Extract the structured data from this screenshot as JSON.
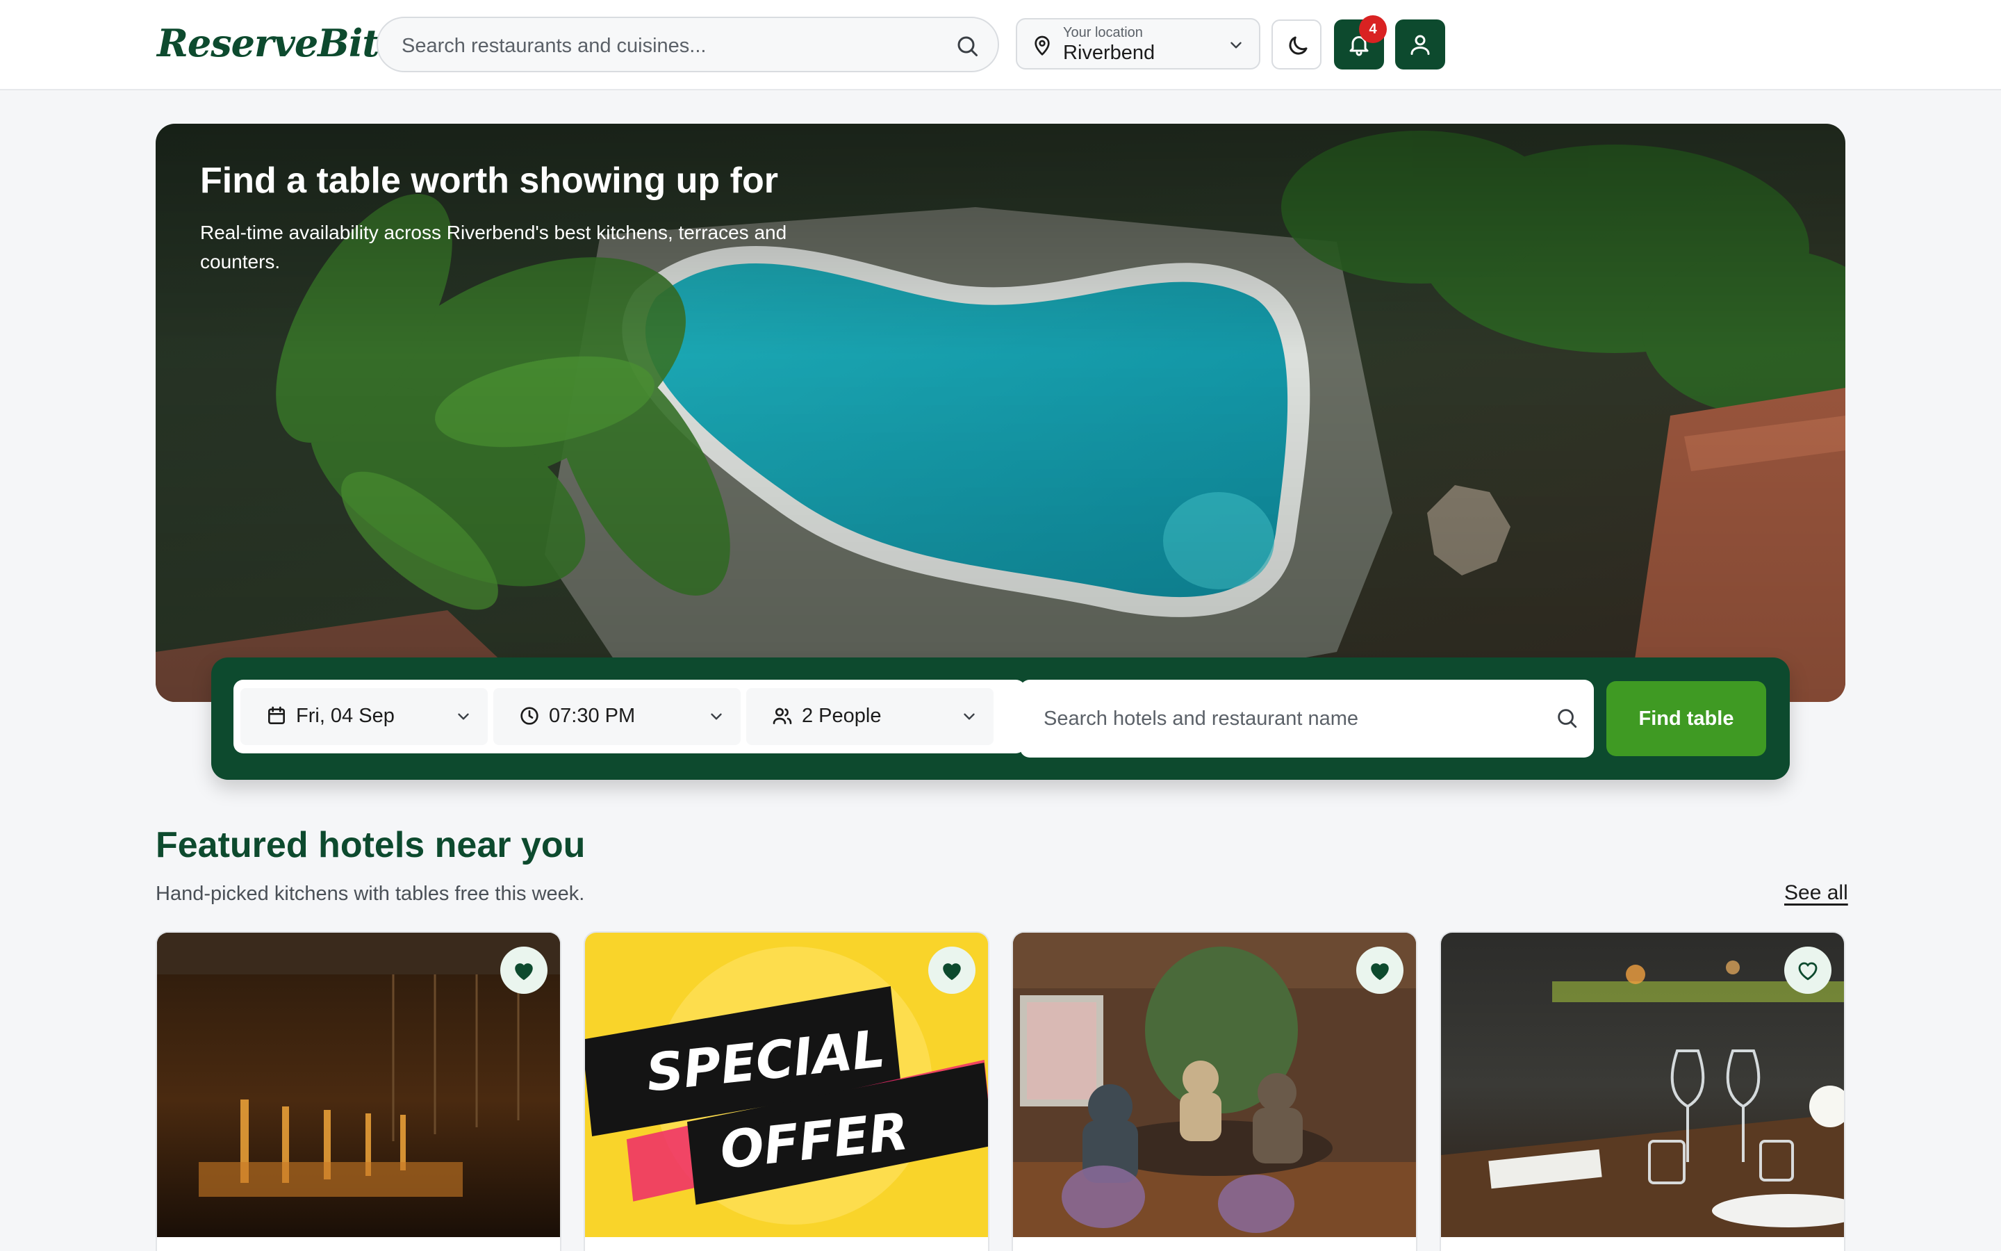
{
  "header": {
    "logo": "ReserveBite",
    "search_placeholder": "Search restaurants and cuisines...",
    "location_label": "Your location",
    "location_value": "Riverbend",
    "notification_count": "4"
  },
  "hero": {
    "title": "Find a table worth showing up for",
    "subtitle": "Real-time availability across Riverbend's best kitchens, terraces and counters."
  },
  "booking": {
    "date": "Fri, 04 Sep",
    "time": "07:30 PM",
    "people": "2 People",
    "search_placeholder": "Search hotels and restaurant name",
    "submit_label": "Find table"
  },
  "featured": {
    "title": "Featured hotels near you",
    "subtitle": "Hand-picked kitchens with tables free this week.",
    "see_all": "See all",
    "cards": [
      {
        "image": "dark-lounge-bar",
        "favorited": true
      },
      {
        "image": "special-offer-banner",
        "favorited": true,
        "banner_text": [
          "SPECIAL",
          "OFFER"
        ]
      },
      {
        "image": "diners-around-table",
        "favorited": true
      },
      {
        "image": "table-setting-wine-glasses",
        "favorited": false
      }
    ]
  },
  "colors": {
    "brand_green": "#0d4a2e",
    "cta_green": "#3f9a23",
    "badge_red": "#d92222"
  }
}
